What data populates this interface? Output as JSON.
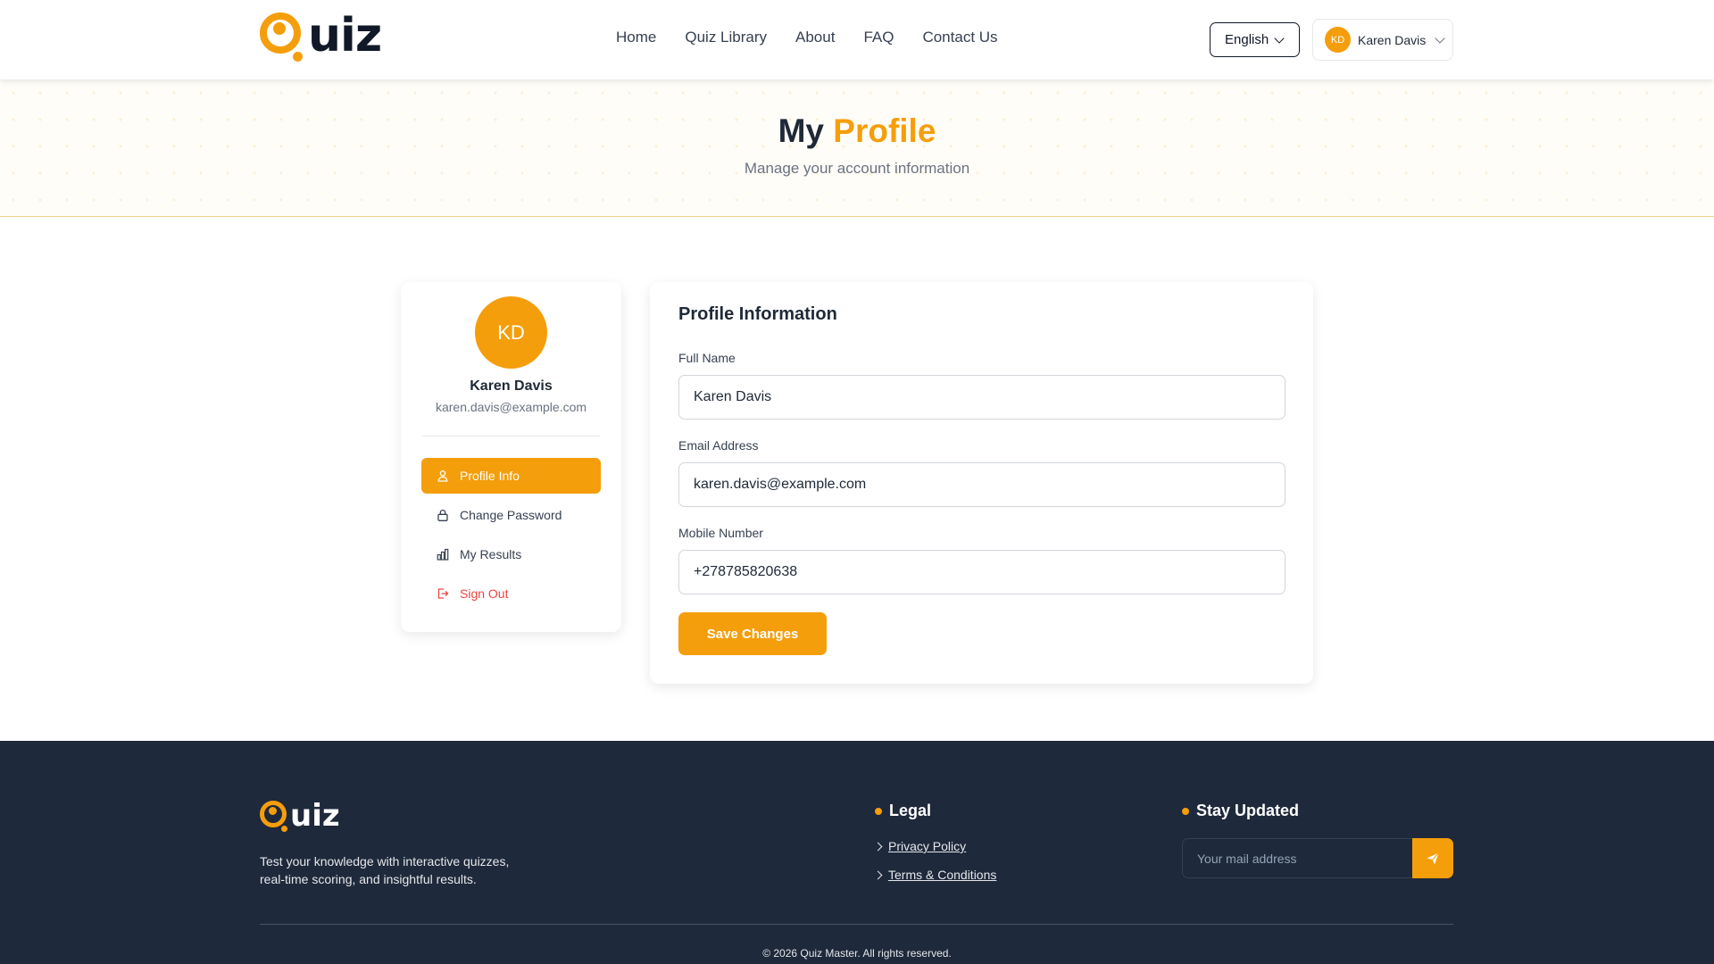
{
  "brand": {
    "logo_text": "uiz",
    "accent_color": "#f59e0b"
  },
  "nav": {
    "items": [
      "Home",
      "Quiz Library",
      "About",
      "FAQ",
      "Contact Us"
    ]
  },
  "header": {
    "language": "English",
    "user": {
      "initials": "KD",
      "name": "Karen Davis"
    }
  },
  "hero": {
    "title_part1": "My",
    "title_part2": "Profile",
    "subtitle": "Manage your account information"
  },
  "sidebar": {
    "initials": "KD",
    "name": "Karen Davis",
    "email": "karen.davis@example.com",
    "menu": [
      {
        "label": "Profile Info",
        "icon": "user-icon",
        "active": true
      },
      {
        "label": "Change Password",
        "icon": "lock-icon",
        "active": false
      },
      {
        "label": "My Results",
        "icon": "bar-chart-icon",
        "active": false
      },
      {
        "label": "Sign Out",
        "icon": "sign-out-icon",
        "active": false
      }
    ]
  },
  "form": {
    "title": "Profile Information",
    "full_name": {
      "label": "Full Name",
      "value": "Karen Davis"
    },
    "email": {
      "label": "Email Address",
      "value": "karen.davis@example.com"
    },
    "mobile": {
      "label": "Mobile Number",
      "value": "+278785820638"
    },
    "save_label": "Save Changes"
  },
  "footer": {
    "logo_text": "uiz",
    "description_line1": "Test your knowledge with interactive quizzes,",
    "description_line2": "real-time scoring, and insightful results.",
    "legal": {
      "heading": "Legal",
      "links": [
        "Privacy Policy",
        "Terms & Conditions"
      ]
    },
    "newsletter": {
      "heading": "Stay Updated",
      "placeholder": "Your mail address",
      "button_icon": "send-icon"
    },
    "copyright": "© 2026 Quiz Master. All rights reserved."
  }
}
